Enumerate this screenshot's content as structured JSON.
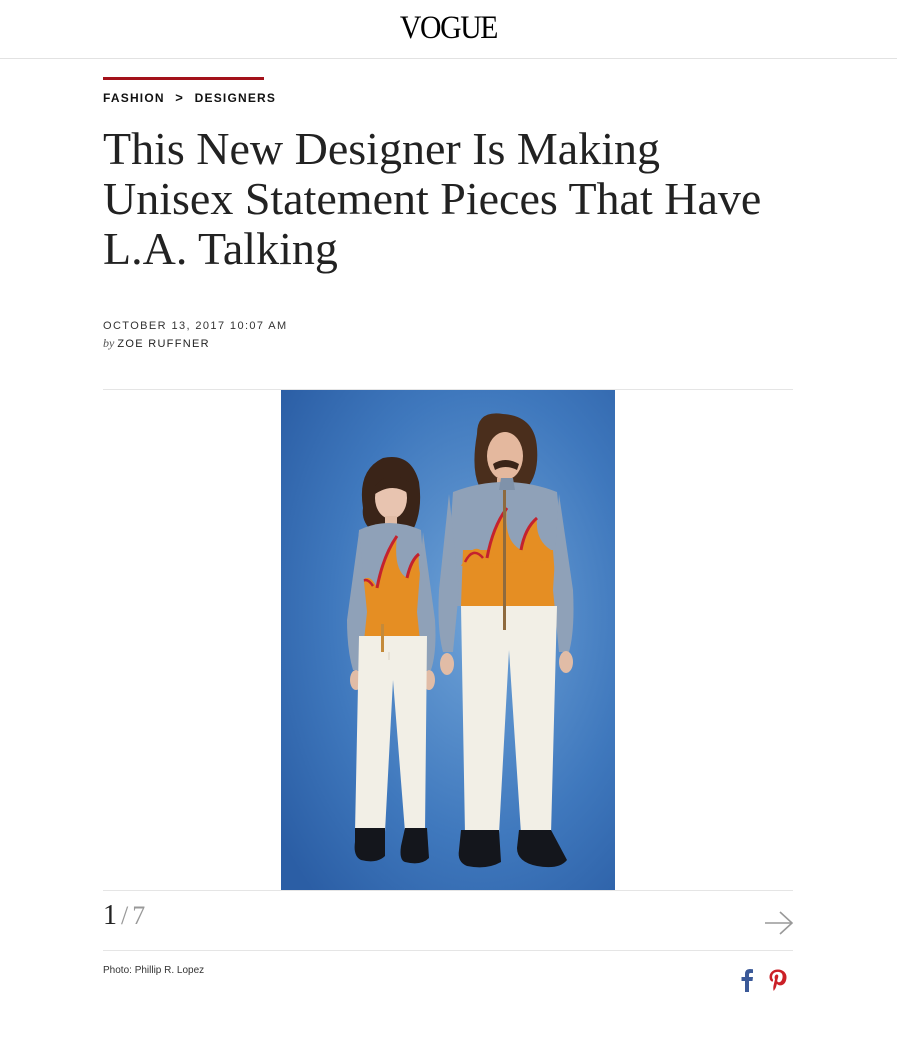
{
  "site": {
    "logo": "VOGUE"
  },
  "breadcrumb": {
    "section": "FASHION",
    "separator": ">",
    "subsection": "DESIGNERS"
  },
  "article": {
    "title": "This New Designer Is Making Unisex Statement Pieces That Have L.A. Talking",
    "date": "OCTOBER 13, 2017 10:07 AM",
    "by": "by",
    "author": "ZOE RUFFNER"
  },
  "gallery": {
    "current": "1",
    "separator": "/",
    "total": "7",
    "credit": "Photo: Phillip R. Lopez",
    "next_icon": "arrow-right-icon"
  },
  "share": {
    "icons": [
      "facebook-icon",
      "pinterest-icon"
    ]
  },
  "colors": {
    "accent_red": "#a3111a",
    "facebook_blue": "#3b5998",
    "pinterest_red": "#cb2027",
    "photo_bg_blue": "#3b73b8"
  }
}
